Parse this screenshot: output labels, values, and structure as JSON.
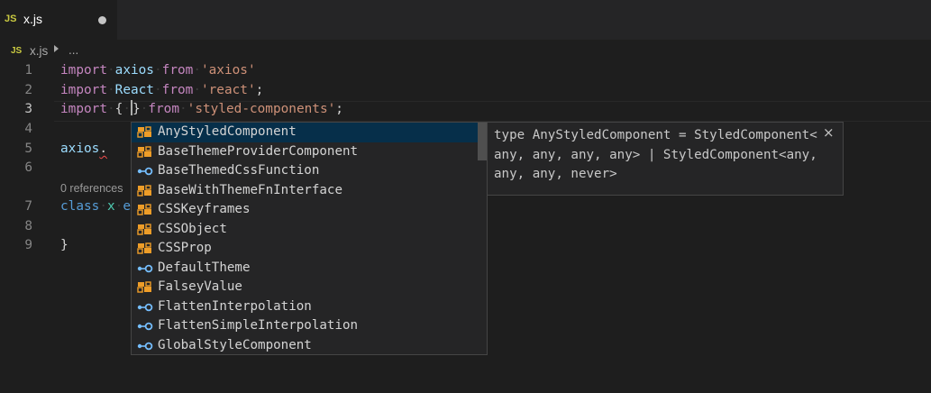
{
  "tab": {
    "badge": "JS",
    "name": "x.js"
  },
  "breadcrumb": {
    "badge": "JS",
    "file": "x.js",
    "more": "..."
  },
  "lines": [
    {
      "n": "1",
      "tokens": [
        {
          "t": "import",
          "c": "kw"
        },
        {
          "t": "·",
          "c": "ws"
        },
        {
          "t": "axios",
          "c": "id"
        },
        {
          "t": "·",
          "c": "ws"
        },
        {
          "t": "from",
          "c": "kw"
        },
        {
          "t": "·",
          "c": "ws"
        },
        {
          "t": "'axios'",
          "c": "str"
        }
      ]
    },
    {
      "n": "2",
      "tokens": [
        {
          "t": "import",
          "c": "kw"
        },
        {
          "t": "·",
          "c": "ws"
        },
        {
          "t": "React",
          "c": "id"
        },
        {
          "t": "·",
          "c": "ws"
        },
        {
          "t": "from",
          "c": "kw"
        },
        {
          "t": "·",
          "c": "ws"
        },
        {
          "t": "'react'",
          "c": "str"
        },
        {
          "t": ";",
          "c": ""
        }
      ]
    },
    {
      "n": "3",
      "tokens": [
        {
          "t": "import",
          "c": "kw"
        },
        {
          "t": "·",
          "c": "ws"
        },
        {
          "t": "{",
          "c": ""
        },
        {
          "t": "·",
          "c": "ws"
        },
        {
          "t": "CURSOR",
          "c": "cursor"
        },
        {
          "t": "}",
          "c": ""
        },
        {
          "t": "·",
          "c": "ws"
        },
        {
          "t": "from",
          "c": "kw"
        },
        {
          "t": "·",
          "c": "ws"
        },
        {
          "t": "'styled-components'",
          "c": "str"
        },
        {
          "t": ";",
          "c": ""
        }
      ]
    },
    {
      "n": "4",
      "tokens": []
    },
    {
      "n": "5",
      "tokens": [
        {
          "t": "axios",
          "c": "id"
        },
        {
          "t": ".",
          "c": "squig"
        }
      ]
    },
    {
      "n": "6",
      "tokens": []
    },
    {
      "n": "7",
      "tokens": [
        {
          "t": "class",
          "c": "dc"
        },
        {
          "t": "·",
          "c": "ws"
        },
        {
          "t": "x",
          "c": "ty"
        },
        {
          "t": "·",
          "c": "ws"
        },
        {
          "t": "e",
          "c": "dc"
        }
      ]
    },
    {
      "n": "8",
      "tokens": []
    },
    {
      "n": "9",
      "tokens": [
        {
          "t": "}",
          "c": ""
        }
      ]
    }
  ],
  "codelens": "0 references",
  "suggestions": [
    {
      "label": "AnyStyledComponent",
      "kind": "interface-icon",
      "selected": true
    },
    {
      "label": "BaseThemeProviderComponent",
      "kind": "interface-icon"
    },
    {
      "label": "BaseThemedCssFunction",
      "kind": "property-icon"
    },
    {
      "label": "BaseWithThemeFnInterface",
      "kind": "interface-icon"
    },
    {
      "label": "CSSKeyframes",
      "kind": "interface-icon"
    },
    {
      "label": "CSSObject",
      "kind": "interface-icon"
    },
    {
      "label": "CSSProp",
      "kind": "interface-icon"
    },
    {
      "label": "DefaultTheme",
      "kind": "property-icon"
    },
    {
      "label": "FalseyValue",
      "kind": "interface-icon"
    },
    {
      "label": "FlattenInterpolation",
      "kind": "property-icon"
    },
    {
      "label": "FlattenSimpleInterpolation",
      "kind": "property-icon"
    },
    {
      "label": "GlobalStyleComponent",
      "kind": "property-icon"
    }
  ],
  "details": {
    "text": "type AnyStyledComponent = StyledComponent<any, any, any, any> | StyledComponent<any, any, any, never>",
    "close_icon": "×"
  },
  "colors": {
    "background": "#1e1e1e",
    "keyword": "#c586c0",
    "string": "#ce9178",
    "variable": "#9cdcfe",
    "selection": "#062f4a",
    "interface_icon": "#ee9d28",
    "property_icon": "#75beff"
  }
}
